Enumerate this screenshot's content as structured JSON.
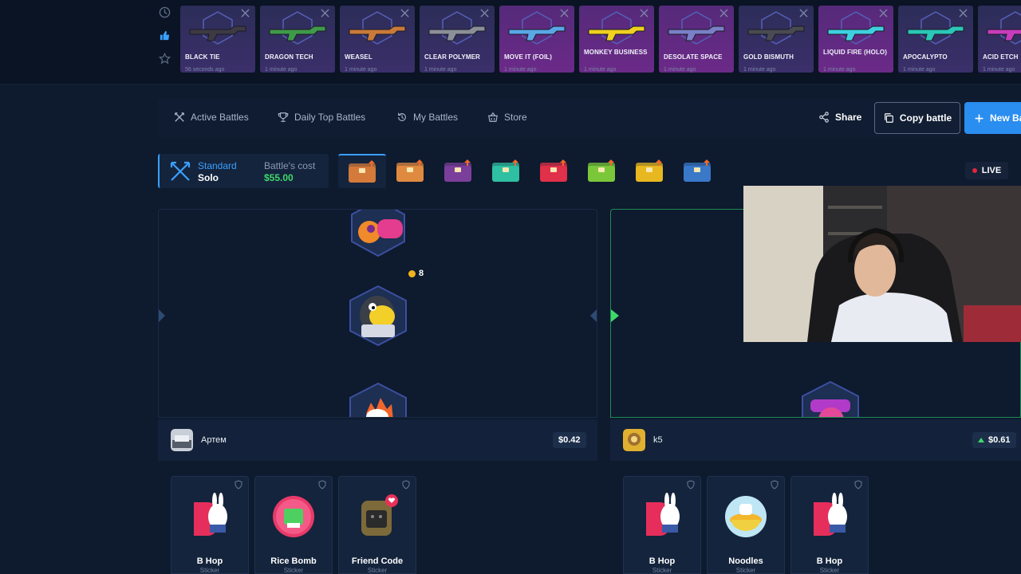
{
  "live_drops": [
    {
      "name": "BLACK TIE",
      "ago": "56 seconds ago",
      "color": "#3d3a44"
    },
    {
      "name": "DRAGON TECH",
      "ago": "1 minute ago",
      "color": "#3f9a4a"
    },
    {
      "name": "WEASEL",
      "ago": "1 minute ago",
      "color": "#c9793a"
    },
    {
      "name": "CLEAR POLYMER",
      "ago": "1 minute ago",
      "color": "#8a8f99"
    },
    {
      "name": "MOVE IT (FOIL)",
      "ago": "1 minute ago",
      "color": "#5aa7e8"
    },
    {
      "name": "MONKEY BUSINESS",
      "ago": "1 minute ago",
      "color": "#f0d020"
    },
    {
      "name": "DESOLATE SPACE",
      "ago": "1 minute ago",
      "color": "#7a7fc8"
    },
    {
      "name": "GOLD BISMUTH",
      "ago": "1 minute ago",
      "color": "#4a4a52"
    },
    {
      "name": "LIQUID FIRE (HOLO)",
      "ago": "1 minute ago",
      "color": "#3fd0e0"
    },
    {
      "name": "APOCALYPTO",
      "ago": "1 minute ago",
      "color": "#2ac7b8"
    },
    {
      "name": "ACID ETCH",
      "ago": "1 minute ago",
      "color": "#c83cbd"
    }
  ],
  "nav": {
    "active_battles": "Active Battles",
    "daily_top": "Daily Top Battles",
    "my_battles": "My Battles",
    "store": "Store",
    "share": "Share",
    "copy_battle": "Copy battle",
    "new_battle": "New Ba"
  },
  "battle": {
    "mode": "Standard",
    "type": "Solo",
    "cost_label": "Battle's cost",
    "cost": "$55.00",
    "live": "LIVE"
  },
  "cases": [
    {
      "name": "case-1",
      "color": "#d47a3a"
    },
    {
      "name": "case-2",
      "color": "#e08a40"
    },
    {
      "name": "case-3",
      "color": "#7a3f9a"
    },
    {
      "name": "case-4",
      "color": "#2fbfa2"
    },
    {
      "name": "case-5",
      "color": "#e0304a"
    },
    {
      "name": "case-6",
      "color": "#7ac83a"
    },
    {
      "name": "case-7",
      "color": "#e8b820"
    },
    {
      "name": "case-8",
      "color": "#3a78c8"
    }
  ],
  "reel1_coin": "8",
  "players": [
    {
      "name": "Артем",
      "total": "$0.42",
      "items": [
        {
          "name": "B Hop",
          "type": "Sticker"
        },
        {
          "name": "Rice Bomb",
          "type": "Sticker"
        },
        {
          "name": "Friend Code",
          "type": "Sticker"
        }
      ]
    },
    {
      "name": "k5",
      "total": "$0.61",
      "items": [
        {
          "name": "B Hop",
          "type": "Sticker"
        },
        {
          "name": "Noodles",
          "type": "Sticker"
        },
        {
          "name": "B Hop",
          "type": "Sticker"
        }
      ]
    }
  ],
  "colors": {
    "accent": "#2a8df0",
    "win": "#3fd86a",
    "live": "#e0263a",
    "bg": "#0e1a2e"
  }
}
